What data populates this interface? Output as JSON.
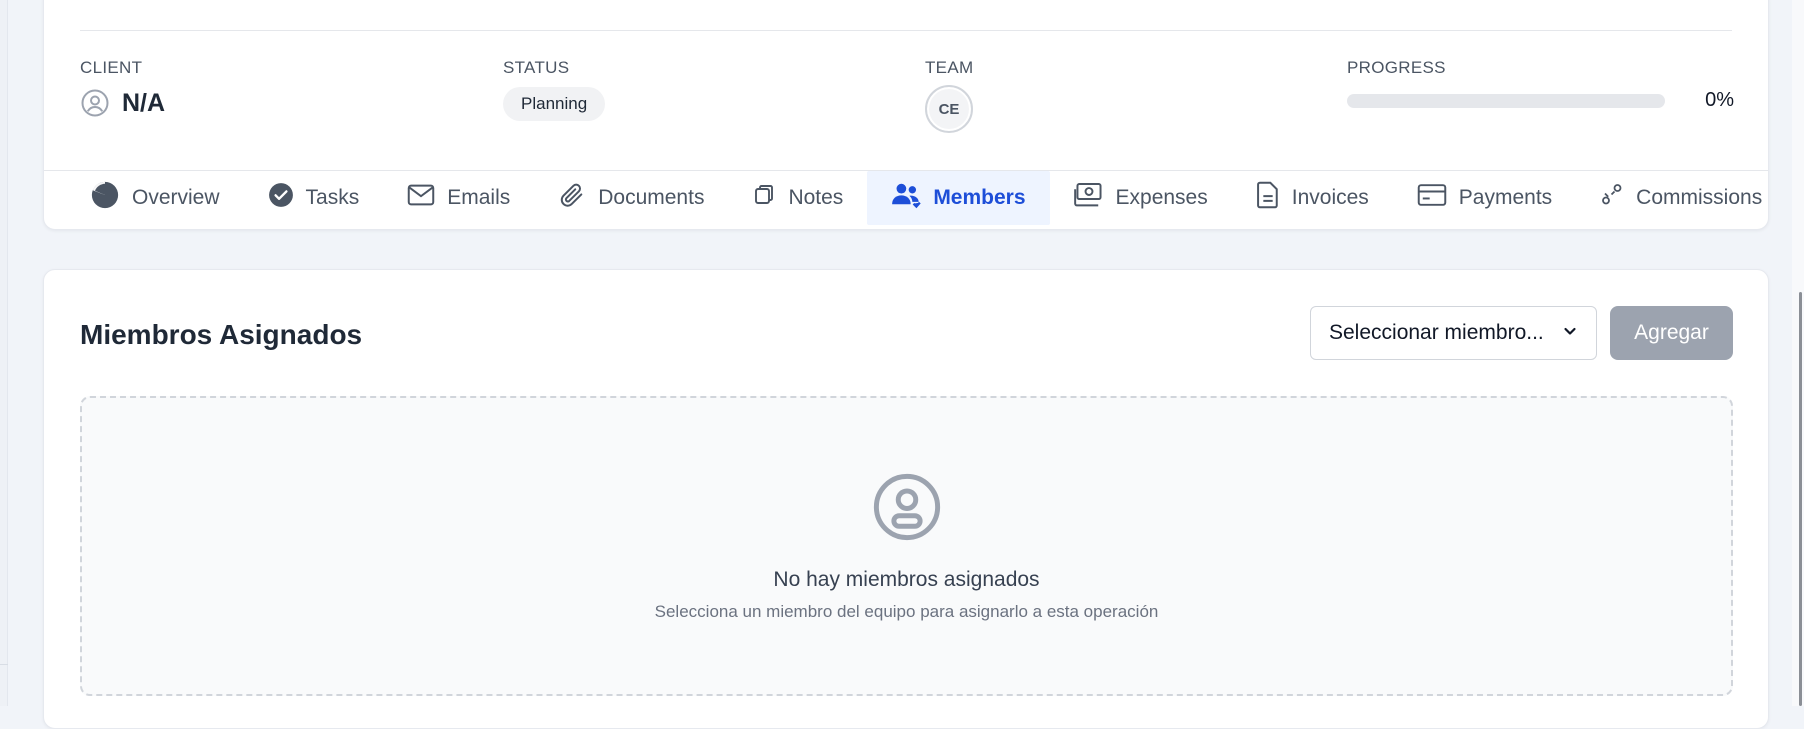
{
  "meta": {
    "client": {
      "label": "CLIENT",
      "value": "N/A",
      "icon": "user-circle-icon"
    },
    "status": {
      "label": "STATUS",
      "value": "Planning"
    },
    "team": {
      "label": "TEAM",
      "avatar_initials": "CE"
    },
    "progress": {
      "label": "PROGRESS",
      "value": 0,
      "text": "0%"
    }
  },
  "tabs": [
    {
      "label": "Overview",
      "icon": "pie-chart-icon",
      "active": false
    },
    {
      "label": "Tasks",
      "icon": "check-circle-icon",
      "active": false
    },
    {
      "label": "Emails",
      "icon": "envelope-icon",
      "active": false
    },
    {
      "label": "Documents",
      "icon": "paperclip-icon",
      "active": false
    },
    {
      "label": "Notes",
      "icon": "notes-icon",
      "active": false
    },
    {
      "label": "Members",
      "icon": "users-icon",
      "active": true
    },
    {
      "label": "Expenses",
      "icon": "cash-icon",
      "active": false
    },
    {
      "label": "Invoices",
      "icon": "document-icon",
      "active": false
    },
    {
      "label": "Payments",
      "icon": "credit-card-icon",
      "active": false
    },
    {
      "label": "Commissions",
      "icon": "commission-icon",
      "active": false
    }
  ],
  "members": {
    "title": "Miembros Asignados",
    "select_value": "Seleccionar miembro...",
    "add_label": "Agregar",
    "empty_title": "No hay miembros asignados",
    "empty_subtitle": "Selecciona un miembro del equipo para asignarlo a esta operación"
  },
  "colors": {
    "accent": "#1d4ed8",
    "active_tab_bg": "#eef4ff",
    "disabled_button": "#9ca3af"
  }
}
